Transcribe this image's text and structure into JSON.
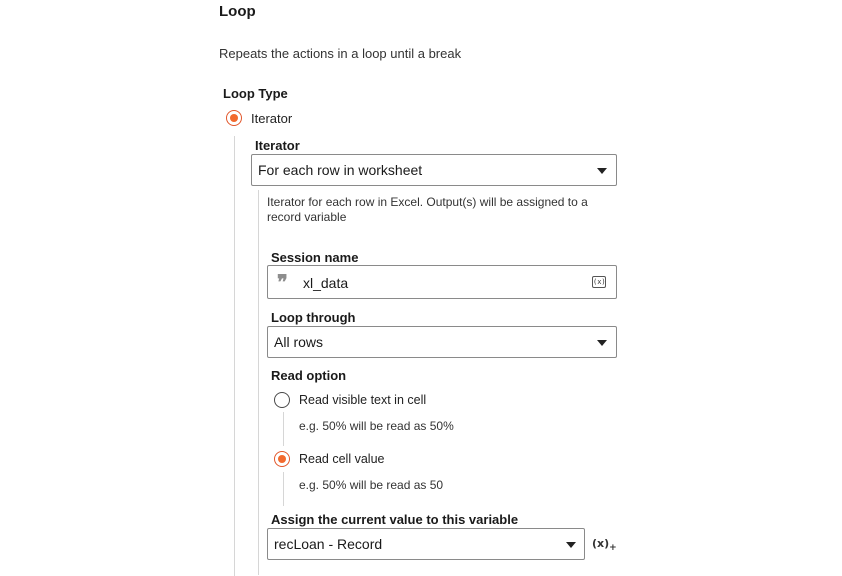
{
  "section": {
    "title": "Loop",
    "description": "Repeats the actions in a loop until a break"
  },
  "loop_type": {
    "label": "Loop Type",
    "option_iterator": "Iterator"
  },
  "iterator": {
    "label": "Iterator",
    "selected": "For each row in worksheet",
    "help": "Iterator for each row in Excel. Output(s) will be assigned to a record variable"
  },
  "session": {
    "label": "Session name",
    "value": "xl_data",
    "quote_icon": "❞",
    "var_icon": "(x)"
  },
  "loop_through": {
    "label": "Loop through",
    "selected": "All rows"
  },
  "read_option": {
    "label": "Read option",
    "opt1": "Read visible text in cell",
    "opt1_example": "e.g. 50% will be read as 50%",
    "opt2": "Read cell value",
    "opt2_example": "e.g. 50% will be read as 50",
    "selected": "Read cell value"
  },
  "assign": {
    "label": "Assign the current value to this variable",
    "selected": "recLoan - Record",
    "add_var_icon": "(x)",
    "add_var_plus": "+"
  },
  "colors": {
    "accent": "#f26a2e",
    "border": "#8a8a8a"
  }
}
